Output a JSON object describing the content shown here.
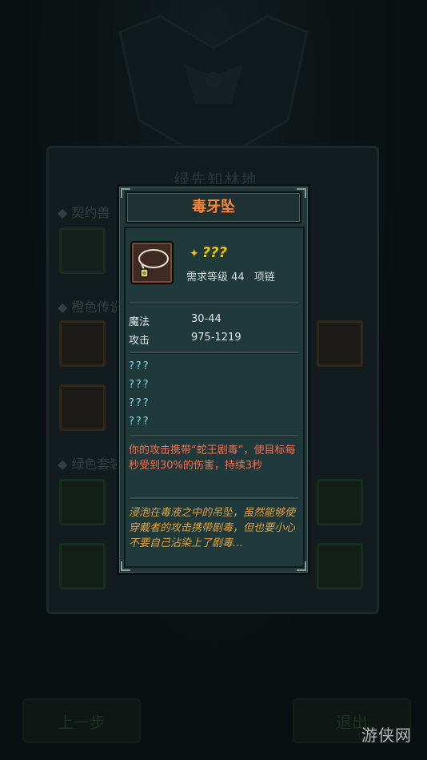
{
  "background": {
    "area_title": "绿先知林地",
    "sections": [
      "契约兽",
      "橙色传说",
      "绿色套装"
    ],
    "buttons": {
      "prev": "上一步",
      "exit": "退出"
    },
    "watermark": "游侠网"
  },
  "tooltip": {
    "title": "毒牙坠",
    "rank": "???",
    "rank_symbol": "✦",
    "requirement": "需求等级 44",
    "item_type": "项链",
    "stats": [
      {
        "label": "魔法",
        "value": "30-44"
      },
      {
        "label": "攻击",
        "value": "975-1219"
      }
    ],
    "unknown_affixes": [
      "???",
      "???",
      "???",
      "???"
    ],
    "effect": "你的攻击携带“蛇王剧毒”，使目标每秒受到30%的伤害，持续3秒",
    "lore": "浸泡在毒液之中的吊坠，虽然能够使穿戴者的攻击携带剧毒，但也要小心不要自己沾染上了剧毒…",
    "colors": {
      "title": "#f08a3c",
      "rank": "#f0c018",
      "unknown_affix": "#7fdce8",
      "effect": "#ff6a4a",
      "lore": "#e2a23e"
    }
  }
}
